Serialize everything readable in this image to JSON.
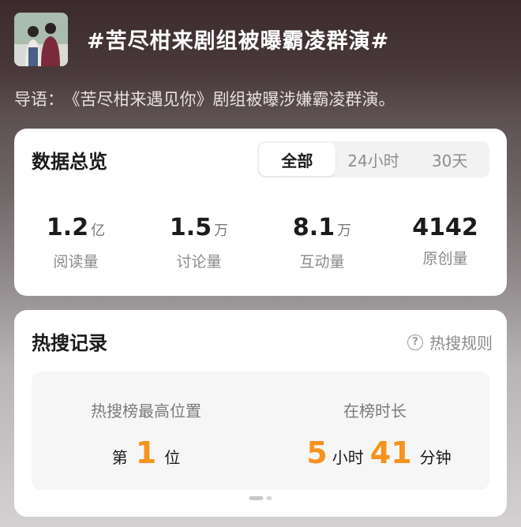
{
  "topic": {
    "title": "#苦尽柑来剧组被曝霸凌群演#",
    "intro_label": "导语：",
    "intro_text": "《苦尽柑来遇见你》剧组被曝涉嫌霸凌群演。"
  },
  "overview": {
    "title": "数据总览",
    "tabs": [
      {
        "label": "全部",
        "active": true
      },
      {
        "label": "24小时",
        "active": false
      },
      {
        "label": "30天",
        "active": false
      }
    ],
    "stats": [
      {
        "value": "1.2",
        "unit": "亿",
        "label": "阅读量"
      },
      {
        "value": "1.5",
        "unit": "万",
        "label": "讨论量"
      },
      {
        "value": "8.1",
        "unit": "万",
        "label": "互动量"
      },
      {
        "value": "4142",
        "unit": "",
        "label": "原创量"
      }
    ]
  },
  "hot": {
    "title": "热搜记录",
    "rules_label": "热搜规则",
    "peak": {
      "label": "热搜榜最高位置",
      "prefix": "第",
      "value": "1",
      "suffix": "位"
    },
    "duration": {
      "label": "在榜时长",
      "hours": "5",
      "hours_unit": "小时",
      "minutes": "41",
      "minutes_unit": "分钟"
    }
  },
  "colors": {
    "accent": "#f7931e",
    "card": "#ffffff",
    "muted_text": "#8a8a8a"
  }
}
